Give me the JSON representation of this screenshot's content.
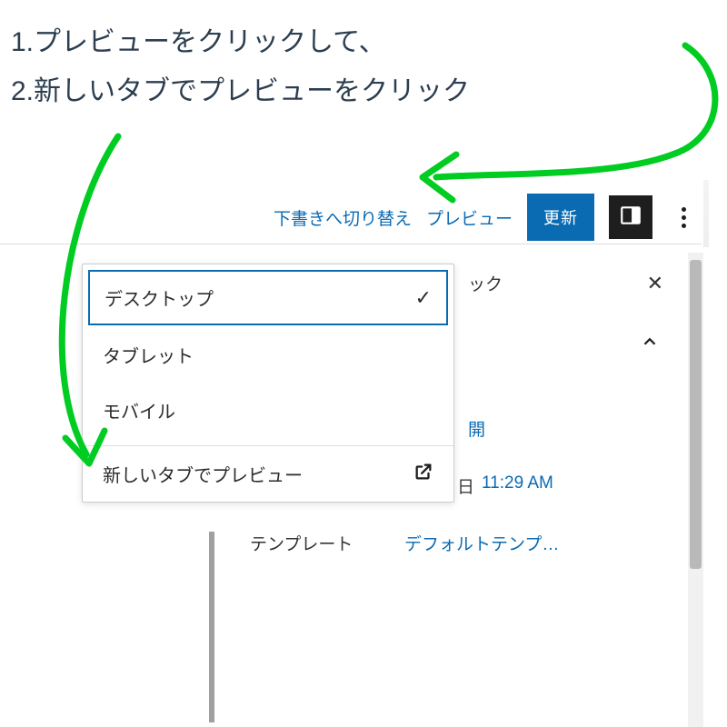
{
  "annotations": {
    "line1": "1.プレビューをクリックして、",
    "line2": "2.新しいタブでプレビューをクリック"
  },
  "toolbar": {
    "switch_to_draft": "下書きへ切り替え",
    "preview": "プレビュー",
    "update": "更新"
  },
  "dropdown": {
    "desktop": "デスクトップ",
    "tablet": "タブレット",
    "mobile": "モバイル",
    "preview_new_tab": "新しいタブでプレビュー"
  },
  "panel": {
    "tab_partial": "ック",
    "link1": "開",
    "date_suffix": "日",
    "time": "11:29 AM",
    "template_label": "テンプレート",
    "template_value": "デフォルトテンプ…"
  },
  "colors": {
    "accent": "#0a6bb3",
    "annotation_arrow": "#00d020"
  }
}
